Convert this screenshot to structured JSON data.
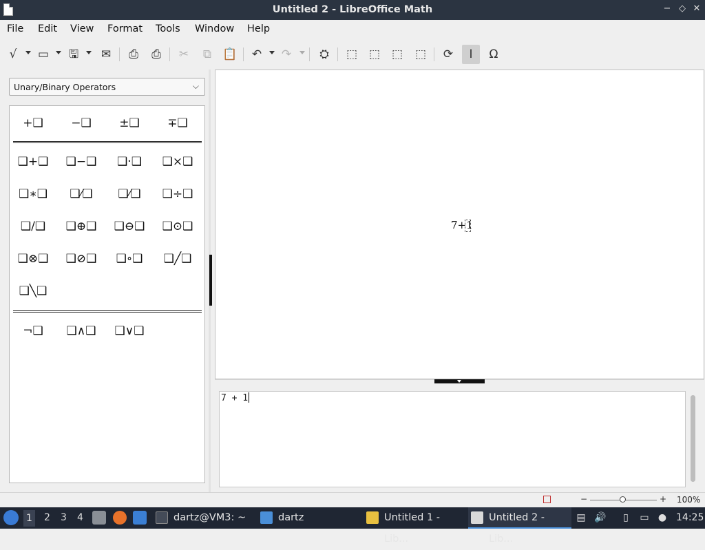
{
  "window": {
    "title": "Untitled 2 - LibreOffice Math",
    "minimize_glyph": "−",
    "restore_glyph": "◇",
    "close_glyph": "✕"
  },
  "menu": [
    "File",
    "Edit",
    "View",
    "Format",
    "Tools",
    "Window",
    "Help"
  ],
  "toolbar": {
    "items": [
      {
        "name": "formula-icon",
        "glyph": "√"
      },
      {
        "name": "open-icon",
        "glyph": "▭"
      },
      {
        "name": "save-icon",
        "glyph": "🖫"
      },
      {
        "name": "email-icon",
        "glyph": "✉"
      },
      {
        "name": "export-pdf-icon",
        "glyph": "⎙"
      },
      {
        "name": "print-icon",
        "glyph": "⎙"
      },
      {
        "name": "cut-icon",
        "glyph": "✂"
      },
      {
        "name": "copy-icon",
        "glyph": "⧉"
      },
      {
        "name": "paste-icon",
        "glyph": "📋"
      },
      {
        "name": "undo-icon",
        "glyph": "↶"
      },
      {
        "name": "redo-icon",
        "glyph": "↷"
      },
      {
        "name": "help-icon",
        "glyph": "⛭"
      },
      {
        "name": "zoom-in-icon",
        "glyph": "⬚"
      },
      {
        "name": "zoom-out-icon",
        "glyph": "⬚"
      },
      {
        "name": "show-all-icon",
        "glyph": "⬚"
      },
      {
        "name": "zoom-100-icon",
        "glyph": "⬚"
      },
      {
        "name": "update-icon",
        "glyph": "⟳"
      },
      {
        "name": "formula-cursor-icon",
        "glyph": "I"
      },
      {
        "name": "symbols-icon",
        "glyph": "Ω"
      }
    ]
  },
  "sidebar": {
    "category": "Unary/Binary Operators",
    "elements": [
      [
        "+❑",
        "−❑",
        "±❑",
        "∓❑"
      ],
      [
        "❑+❑",
        "❑−❑",
        "❑·❑",
        "❑×❑"
      ],
      [
        "❑∗❑",
        "❑⁄❑",
        "❑⁄❑",
        "❑÷❑"
      ],
      [
        "❑/❑",
        "❑⊕❑",
        "❑⊖❑",
        "❑⊙❑"
      ],
      [
        "❑⊗❑",
        "❑⊘❑",
        "❑∘❑",
        "❑╱❑"
      ],
      [
        "❑╲❑"
      ],
      [
        "¬❑",
        "❑∧❑",
        "❑∨❑"
      ]
    ]
  },
  "formula": {
    "rendered": "7+1",
    "command": "7 + 1"
  },
  "statusbar": {
    "zoom": "100%",
    "zoom_level_percent": 100
  },
  "taskbar": {
    "workspaces": [
      "1",
      "2",
      "3",
      "4"
    ],
    "tasks": [
      {
        "label": "dartz@VM3: ~",
        "icon": "terminal-icon",
        "color": "#444b58"
      },
      {
        "label": "dartz",
        "icon": "folder-icon",
        "color": "#4a8fd8"
      },
      {
        "label": "Untitled 1 - Lib...",
        "icon": "libreoffice-doc-icon",
        "color": "#e8c040"
      },
      {
        "label": "Untitled 2 - Lib...",
        "icon": "libreoffice-math-icon",
        "color": "#d9d9d9"
      }
    ],
    "clock": "14:25"
  },
  "colors": {
    "titlebar": "#2b3441",
    "taskbar": "#1f2633",
    "accent": "#4a90d9"
  }
}
